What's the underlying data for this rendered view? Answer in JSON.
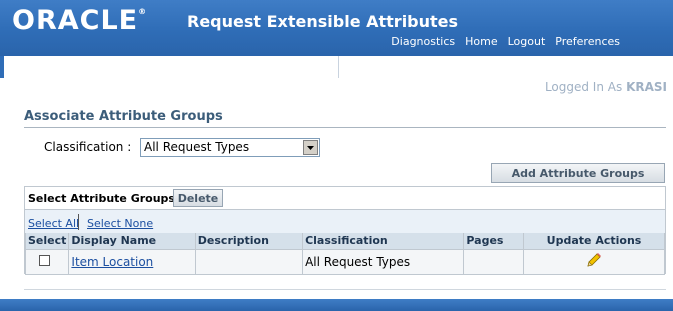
{
  "header": {
    "logo_text": "ORACLE",
    "logo_mark": "®",
    "app_title": "Request Extensible Attributes",
    "links": [
      "Diagnostics",
      "Home",
      "Logout",
      "Preferences"
    ]
  },
  "user": {
    "prefix": "Logged In As",
    "name": "KRASI"
  },
  "page": {
    "title": "Associate Attribute Groups",
    "classification_label": "Classification :",
    "classification_value": "All Request Types"
  },
  "buttons": {
    "add": "Add Attribute Groups",
    "delete": "Delete"
  },
  "table": {
    "control_label": "Select Attribute Groups:",
    "select_all": "Select All",
    "select_none": "Select None",
    "columns": [
      "Select",
      "Display Name",
      "Description",
      "Classification",
      "Pages",
      "Update Actions"
    ],
    "rows": [
      {
        "display_name": "Item Location",
        "description": "",
        "classification": "All Request Types",
        "pages": ""
      }
    ]
  },
  "colors": {
    "header_blue": "#2f6db7",
    "title_color": "#3c5d7a",
    "link_color": "#1c4fa0"
  },
  "icons": {
    "update": "pencil-icon",
    "dropdown": "chevron-down-icon"
  }
}
